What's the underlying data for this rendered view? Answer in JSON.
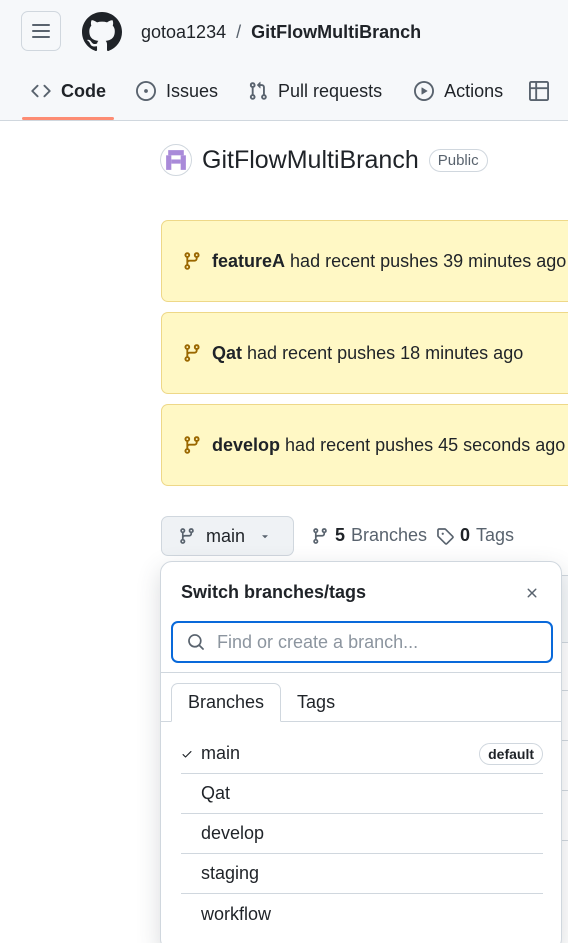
{
  "header": {
    "owner": "gotoa1234",
    "separator": "/",
    "repo": "GitFlowMultiBranch"
  },
  "tabs": [
    {
      "label": "Code",
      "icon": "code-icon",
      "active": true
    },
    {
      "label": "Issues",
      "icon": "issue-icon"
    },
    {
      "label": "Pull requests",
      "icon": "pull-request-icon"
    },
    {
      "label": "Actions",
      "icon": "play-icon"
    },
    {
      "label": "",
      "icon": "table-icon"
    }
  ],
  "repo": {
    "name": "GitFlowMultiBranch",
    "visibility": "Public"
  },
  "banners": [
    {
      "branch": "featureA",
      "text": "had recent pushes 39 minutes ago"
    },
    {
      "branch": "Qat",
      "text": "had recent pushes 18 minutes ago"
    },
    {
      "branch": "develop",
      "text": "had recent pushes 45 seconds ago"
    }
  ],
  "branch_bar": {
    "current": "main",
    "branches_count": "5",
    "branches_label": "Branches",
    "tags_count": "0",
    "tags_label": "Tags"
  },
  "dropdown": {
    "title": "Switch branches/tags",
    "search_placeholder": "Find or create a branch...",
    "tab_branches": "Branches",
    "tab_tags": "Tags",
    "default_label": "default",
    "branches": [
      "main",
      "Qat",
      "develop",
      "staging",
      "workflow"
    ],
    "selected": "main"
  },
  "colors": {
    "accent": "#0969da",
    "banner_bg": "#fff8c5",
    "tab_underline": "#fd8c73",
    "branch_icon": "#9a6700"
  }
}
